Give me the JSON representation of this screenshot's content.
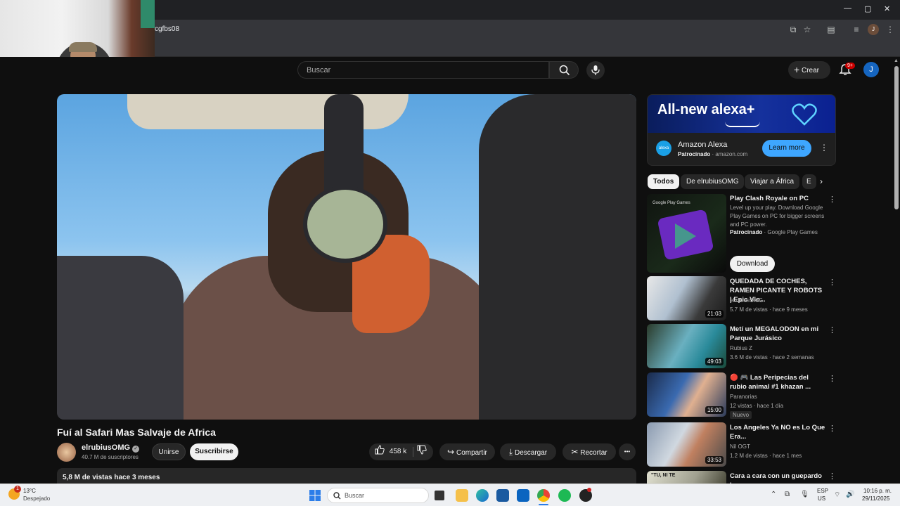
{
  "browser": {
    "url_fragment": "cgfbs08",
    "window_controls": [
      "—",
      "▢",
      "✕"
    ]
  },
  "header": {
    "search_placeholder": "Buscar",
    "create_label": "Crear",
    "notification_count": "9+",
    "avatar_letter": "J"
  },
  "video": {
    "title": "Fuí al Safari Mas Salvaje de Africa",
    "channel": "elrubiusOMG",
    "subscribers": "40.7 M de suscriptores",
    "join_label": "Unirse",
    "subscribe_label": "Suscribirse",
    "likes": "458 k",
    "share_label": "Compartir",
    "download_label": "Descargar",
    "clip_label": "Recortar",
    "more_label": "•••",
    "description_meta": "5,8 M de vistas  hace 3 meses"
  },
  "ad": {
    "banner_text": "All-new alexa+",
    "logo_text": "alexa",
    "title": "Amazon Alexa",
    "sponsored": "Patrocinado",
    "domain": "amazon.com",
    "cta": "Learn more"
  },
  "chips": [
    "Todos",
    "De elrubiusOMG",
    "Viajar a África",
    "E"
  ],
  "promo": {
    "title": "Play Clash Royale on PC",
    "description": "Level up your play. Download Google Play Games on PC for bigger screens and PC power.",
    "sponsored": "Patrocinado",
    "advertiser": "Google Play Games",
    "cta": "Download",
    "thumb_label": "Google Play Games"
  },
  "recommendations": [
    {
      "title": "QUEDADA DE COCHES, RAMEN PICANTE Y ROBOTS | Epic Vlo...",
      "channel": "elrubiusOMG",
      "meta": "5.7 M de vistas · hace 9 meses",
      "duration": "21:03"
    },
    {
      "title": "Metí un MEGALODON en mi Parque Jurásico",
      "channel": "Rubius Z",
      "meta": "3.6 M de vistas · hace 2 semanas",
      "duration": "49:03"
    },
    {
      "title": "🔴 🎮 Las Peripecias del rubio animal #1   khazan ...",
      "channel": "Paranorias",
      "meta": "12 vistas · hace 1 día",
      "duration": "15:00",
      "badge": "Nuevo"
    },
    {
      "title": "Los Angeles Ya NO es Lo Que Era...",
      "channel": "Nil OGT",
      "meta": "1.2 M de vistas · hace 1 mes",
      "duration": "33:53"
    },
    {
      "title": "Cara a cara con un guepardo |",
      "channel": "",
      "meta": "",
      "duration": "",
      "thumb_text": "\"TU, NI TE"
    }
  ],
  "taskbar": {
    "weather_temp": "13°C",
    "weather_desc": "Despejado",
    "weather_alert": "1",
    "search_placeholder": "Buscar",
    "lang_top": "ESP",
    "lang_bottom": "US",
    "time": "10:16 p. m.",
    "date": "29/11/2025"
  },
  "colors": {
    "accent_blue": "#3ea6ff",
    "subscribe_bg": "#f1f1f1",
    "badge_red": "#cc0000"
  }
}
